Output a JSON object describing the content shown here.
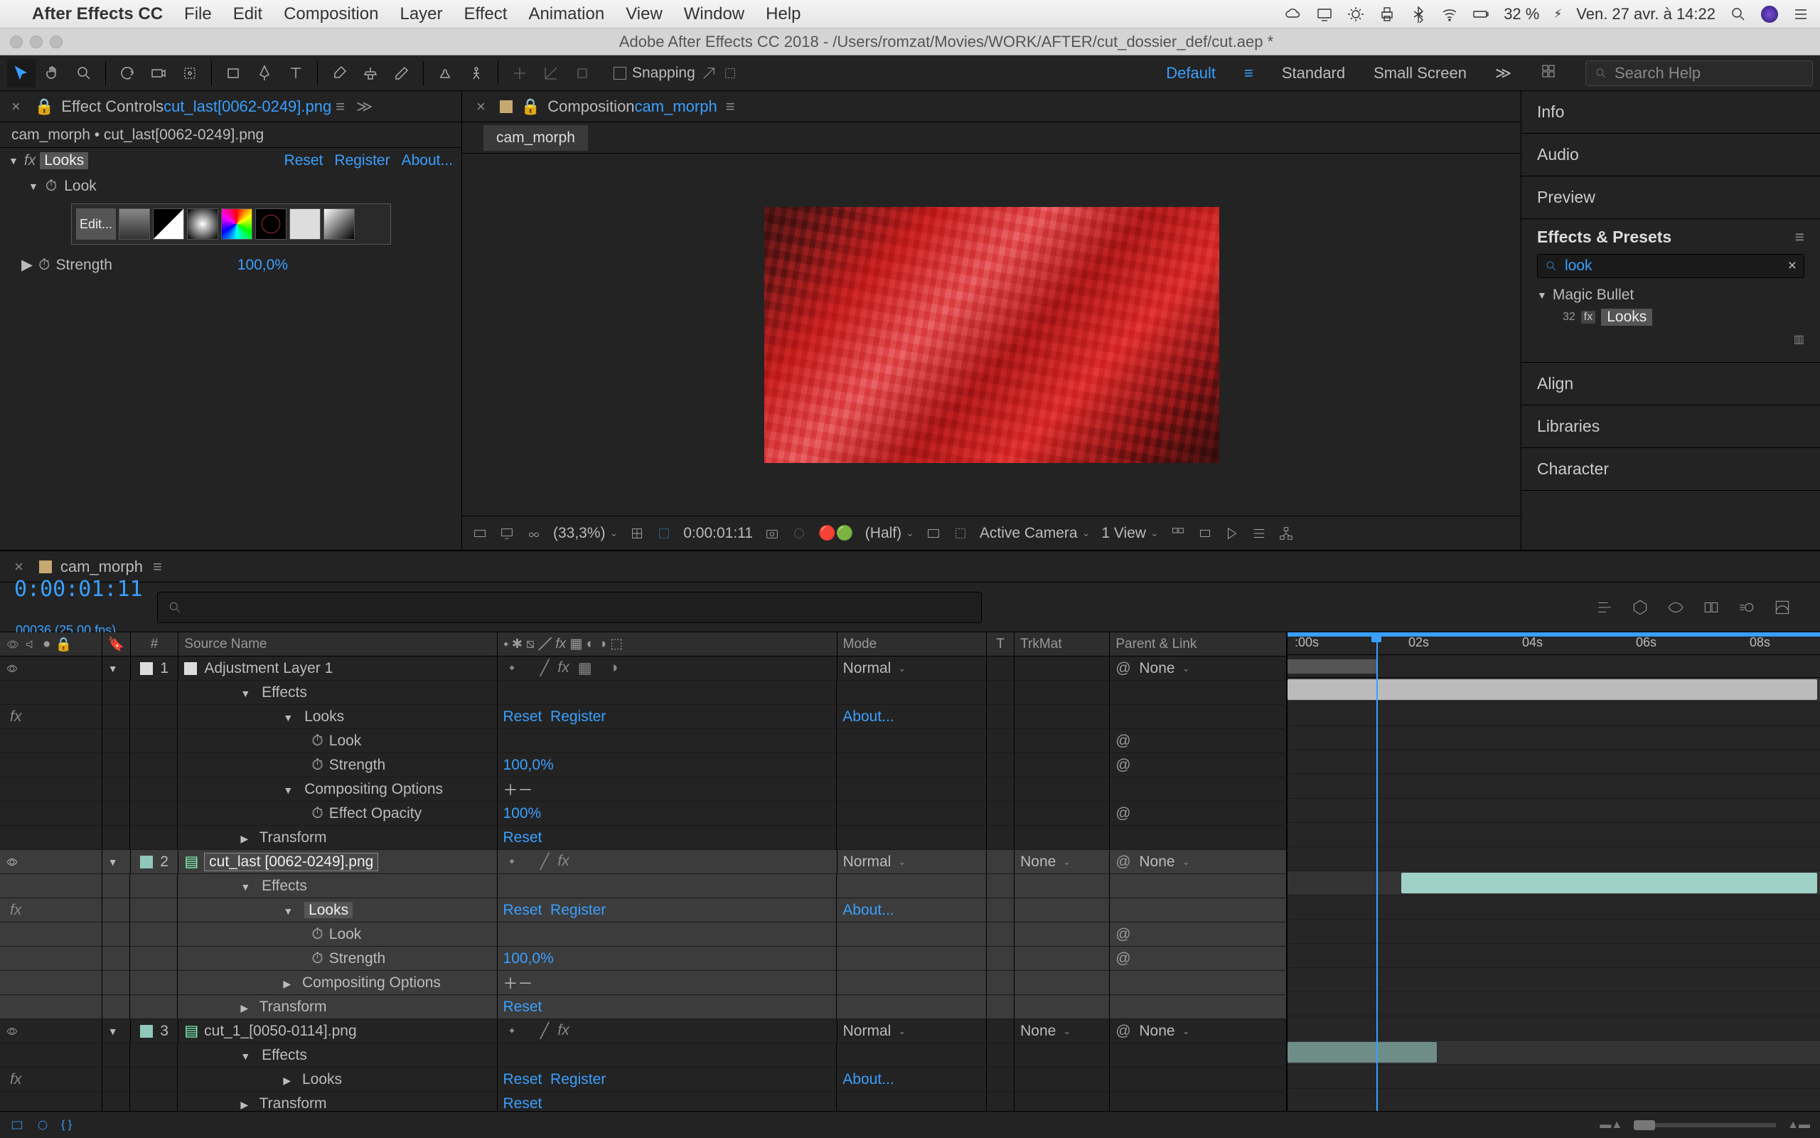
{
  "menubar": {
    "app": "After Effects CC",
    "items": [
      "File",
      "Edit",
      "Composition",
      "Layer",
      "Effect",
      "Animation",
      "View",
      "Window",
      "Help"
    ],
    "battery": "32 %",
    "clock": "Ven. 27 avr. à  14:22"
  },
  "titlebar": "Adobe After Effects CC 2018 - /Users/romzat/Movies/WORK/AFTER/cut_dossier_def/cut.aep *",
  "toolstrip": {
    "snapping": "Snapping",
    "workspaces": [
      "Default",
      "Standard",
      "Small Screen"
    ],
    "search_placeholder": "Search Help"
  },
  "effectControls": {
    "panel_label": "Effect Controls ",
    "file": "cut_last[0062-0249].png",
    "breadcrumb": "cam_morph • cut_last[0062-0249].png",
    "effect": "Looks",
    "links": {
      "reset": "Reset",
      "register": "Register",
      "about": "About..."
    },
    "look_label": "Look",
    "edit": "Edit...",
    "strength_label": "Strength",
    "strength_value": "100,0%"
  },
  "composition": {
    "panel_label": "Composition ",
    "name": "cam_morph",
    "tab": "cam_morph",
    "viewbar": {
      "zoom": "(33,3%)",
      "time": "0:00:01:11",
      "res": "(Half)",
      "camera": "Active Camera",
      "view": "1 View"
    }
  },
  "rightPanels": {
    "info": "Info",
    "audio": "Audio",
    "preview": "Preview",
    "ep_title": "Effects & Presets",
    "ep_search": "look",
    "folder": "Magic Bullet",
    "item": "Looks",
    "align": "Align",
    "libraries": "Libraries",
    "character": "Character"
  },
  "timeline": {
    "tab": "cam_morph",
    "time": "0:00:01:11",
    "fps": "00036 (25.00 fps)",
    "ruler": [
      ":00s",
      "02s",
      "04s",
      "06s",
      "08s"
    ],
    "headers": {
      "num": "#",
      "source": "Source Name",
      "mode": "Mode",
      "t": "T",
      "trk": "TrkMat",
      "parent": "Parent & Link"
    },
    "common": {
      "reset": "Reset",
      "register": "Register",
      "about": "About...",
      "normal": "Normal",
      "none": "None",
      "effects": "Effects",
      "transform": "Transform",
      "looks": "Looks",
      "look": "Look",
      "strength": "Strength",
      "strength_val": "100,0%",
      "compOpt": "Compositing Options",
      "effOpacity": "Effect Opacity",
      "opacity_val": "100%"
    },
    "layers": {
      "l1": {
        "num": "1",
        "name": "Adjustment Layer 1"
      },
      "l2": {
        "num": "2",
        "name": "cut_last [0062-0249].png"
      },
      "l3": {
        "num": "3",
        "name": "cut_1_[0050-0114].png"
      }
    }
  }
}
